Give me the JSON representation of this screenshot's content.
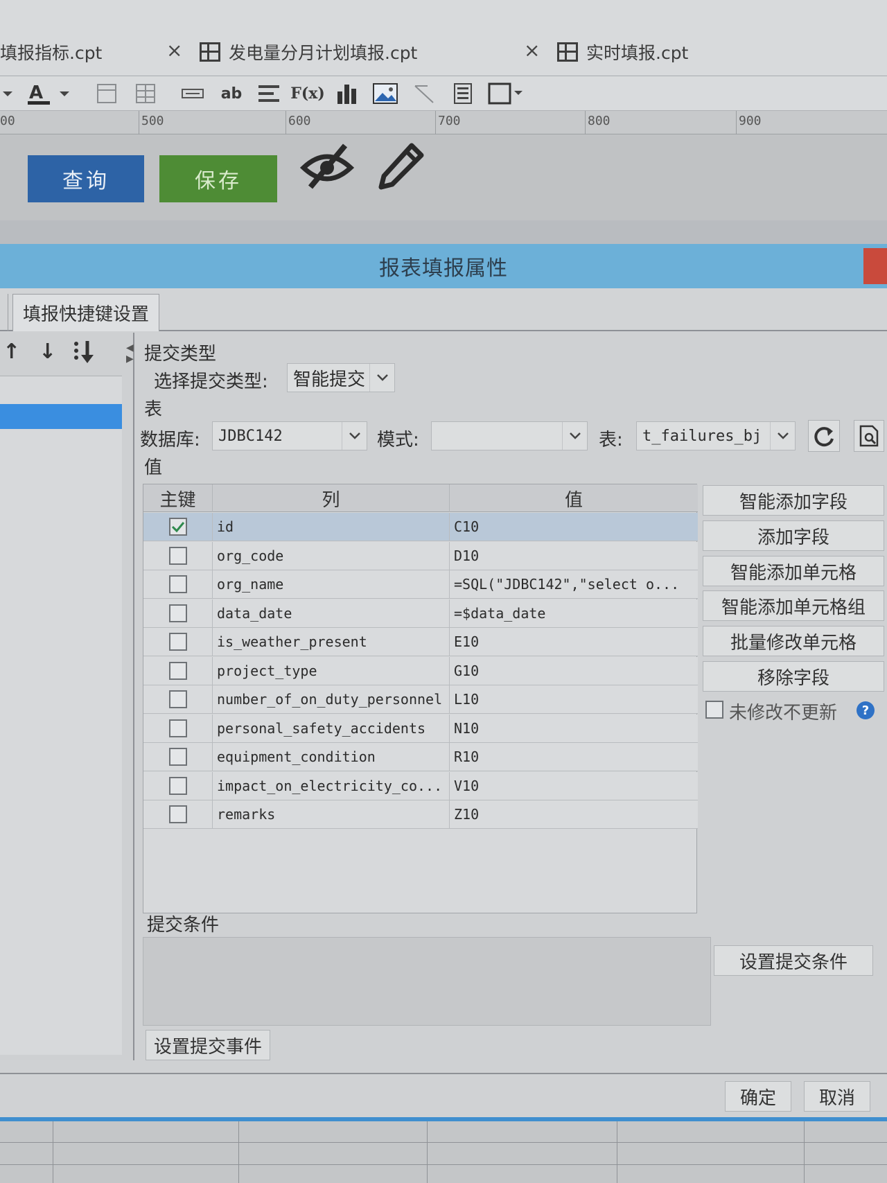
{
  "tabs": [
    {
      "label": "填报指标.cpt"
    },
    {
      "label": "发电量分月计划填报.cpt"
    },
    {
      "label": "实时填报.cpt"
    }
  ],
  "toolbar": {
    "text_tool": "ab",
    "formula_tool": "F(x)"
  },
  "ruler": [
    "00",
    "500",
    "600",
    "700",
    "800",
    "900"
  ],
  "canvas": {
    "query_label": "查询",
    "save_label": "保存"
  },
  "dialog": {
    "title": "报表填报属性",
    "tab_label": "填报快捷键设置",
    "submit_type_section": "提交类型",
    "select_submit_type_label": "选择提交类型:",
    "submit_type_value": "智能提交",
    "table_section": "表",
    "database_label": "数据库:",
    "database_value": "JDBC142",
    "schema_label": "模式:",
    "schema_value": "",
    "table_label": "表:",
    "table_value": "t_failures_bj",
    "value_section": "值",
    "grid": {
      "headers": {
        "key": "主键",
        "column": "列",
        "value": "值"
      },
      "rows": [
        {
          "key": true,
          "column": "id",
          "value": "C10"
        },
        {
          "key": false,
          "column": "org_code",
          "value": "D10"
        },
        {
          "key": false,
          "column": "org_name",
          "value": "=SQL(\"JDBC142\",\"select o..."
        },
        {
          "key": false,
          "column": "data_date",
          "value": "=$data_date"
        },
        {
          "key": false,
          "column": "is_weather_present",
          "value": "E10"
        },
        {
          "key": false,
          "column": "project_type",
          "value": "G10"
        },
        {
          "key": false,
          "column": "number_of_on_duty_personnel",
          "value": "L10"
        },
        {
          "key": false,
          "column": "personal_safety_accidents",
          "value": "N10"
        },
        {
          "key": false,
          "column": "equipment_condition",
          "value": "R10"
        },
        {
          "key": false,
          "column": "impact_on_electricity_co...",
          "value": "V10"
        },
        {
          "key": false,
          "column": "remarks",
          "value": "Z10"
        }
      ]
    },
    "side_buttons": {
      "smart_add_field": "智能添加字段",
      "add_field": "添加字段",
      "smart_add_cell": "智能添加单元格",
      "smart_add_cell_group": "智能添加单元格组",
      "batch_modify_cell": "批量修改单元格",
      "remove_field": "移除字段"
    },
    "no_update_unmodified": "未修改不更新",
    "submit_condition_section": "提交条件",
    "set_submit_condition": "设置提交条件",
    "set_submit_event": "设置提交事件",
    "ok": "确定",
    "cancel": "取消"
  },
  "colors": {
    "title_bar": "#6cb0d8",
    "query_button": "#2d63a6",
    "save_button": "#4e8c35",
    "selection": "#3a8ee0"
  }
}
